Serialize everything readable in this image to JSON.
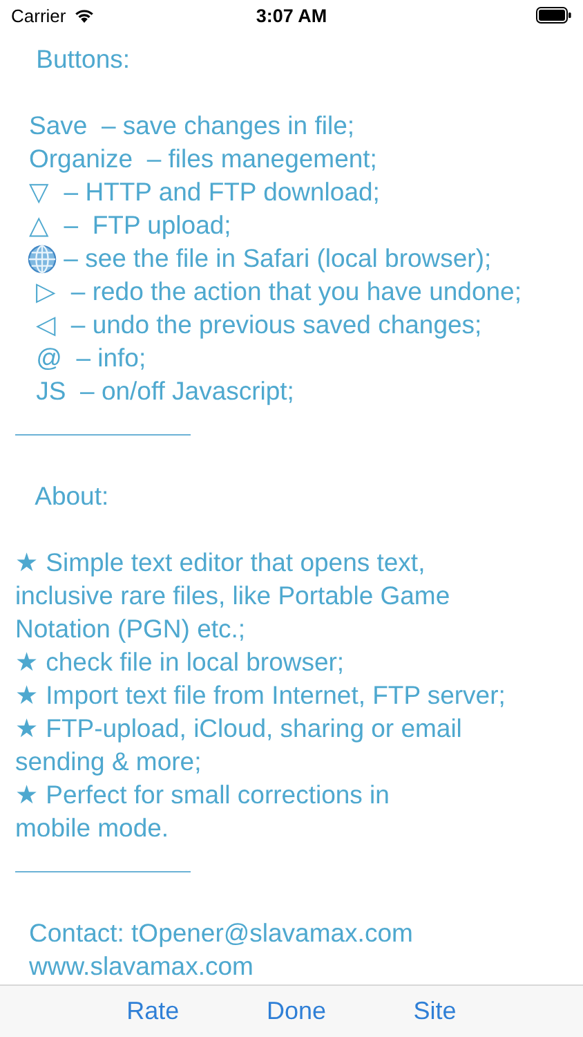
{
  "status_bar": {
    "carrier": "Carrier",
    "time": "3:07 AM"
  },
  "content": [
    {
      "kind": "line",
      "text": " Buttons:"
    },
    {
      "kind": "gap"
    },
    {
      "kind": "line",
      "text": "Save  – save changes in file;"
    },
    {
      "kind": "line",
      "text": "Organize  – files manegement;"
    },
    {
      "kind": "line",
      "text": "▽  – HTTP and FTP download;"
    },
    {
      "kind": "line",
      "text": "△  –  FTP upload;"
    },
    {
      "kind": "globe",
      "text": " – see the file in Safari (local browser);"
    },
    {
      "kind": "line",
      "text": " ▷  – redo the action that you have undone;"
    },
    {
      "kind": "line",
      "text": " ◁  – undo the previous saved changes;"
    },
    {
      "kind": "line",
      "text": " @  – info;"
    },
    {
      "kind": "line",
      "text": " JS  – on/off Javascript;"
    },
    {
      "kind": "rule"
    },
    {
      "kind": "line",
      "text": " About:"
    },
    {
      "kind": "gap"
    },
    {
      "kind": "line",
      "text": "★ Simple text editor that opens text,"
    },
    {
      "kind": "line",
      "text": "inclusive rare files, like Portable Game"
    },
    {
      "kind": "line",
      "text": "Notation (PGN) etc.;"
    },
    {
      "kind": "line",
      "text": "★ check file in local browser;"
    },
    {
      "kind": "line",
      "text": "★ Import text file from Internet, FTP server;"
    },
    {
      "kind": "line",
      "text": "★ FTP-upload, iCloud, sharing or email"
    },
    {
      "kind": "line",
      "text": "sending & more;"
    },
    {
      "kind": "line",
      "text": "★ Perfect for small corrections in"
    },
    {
      "kind": "line",
      "text": "mobile mode."
    },
    {
      "kind": "rule"
    },
    {
      "kind": "line",
      "text": "Contact: tOpener@slavamax.com"
    },
    {
      "kind": "line",
      "text": "www.slavamax.com"
    }
  ],
  "toolbar": [
    "Rate",
    "Done",
    "Site"
  ]
}
